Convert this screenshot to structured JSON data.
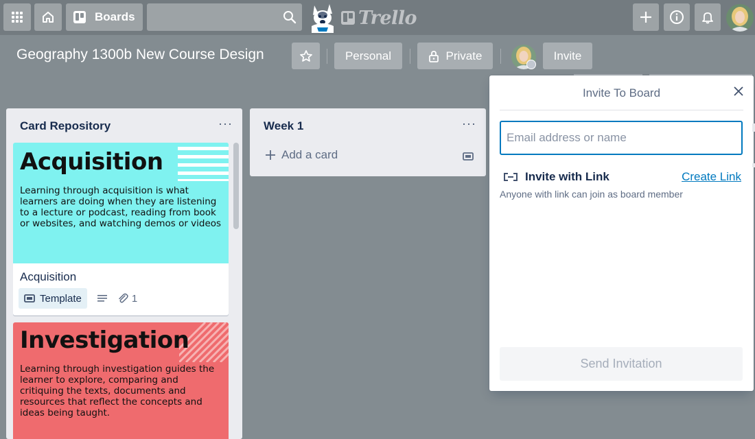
{
  "topnav": {
    "boards_label": "Boards",
    "logo_text": "Trello",
    "icons": [
      "apps-grid-icon",
      "home-icon",
      "boards-icon",
      "search-icon",
      "plus-icon",
      "info-icon",
      "bell-icon"
    ]
  },
  "board": {
    "title": "Geography 1300b New Course Design",
    "visibility_team": "Personal",
    "visibility": "Private",
    "invite_label": "Invite"
  },
  "lists": [
    {
      "title": "Card Repository",
      "menu": "···",
      "cards": [
        {
          "cover_heading": "Acquisition",
          "cover_text": "Learning through acquisition is what learners are doing when they are listening to a lecture or podcast, reading from book or websites, and watching demos or videos",
          "cover_color": "#7ff2f0",
          "title": "Acquisition",
          "badge_template": "Template",
          "attachments": "1"
        },
        {
          "cover_heading": "Investigation",
          "cover_text": "Learning through investigation guides the learner to explore, comparing and critiquing the texts, documents and resources that reflect the concepts and ideas being taught.",
          "cover_color": "#ef6b6e"
        }
      ]
    },
    {
      "title": "Week 1",
      "menu": "···",
      "add_card": "Add a card"
    }
  ],
  "invite_popover": {
    "title": "Invite To Board",
    "input_placeholder": "Email address or name",
    "invite_link_label": "Invite with Link",
    "create_link": "Create Link",
    "link_description": "Anyone with link can join as board member",
    "send_button": "Send Invitation"
  },
  "colors": {
    "background": "#838c91",
    "topnav": "#737b80",
    "link": "#0079bf",
    "acquisition_cover": "#7ff2f0",
    "investigation_cover": "#ef6b6e"
  }
}
